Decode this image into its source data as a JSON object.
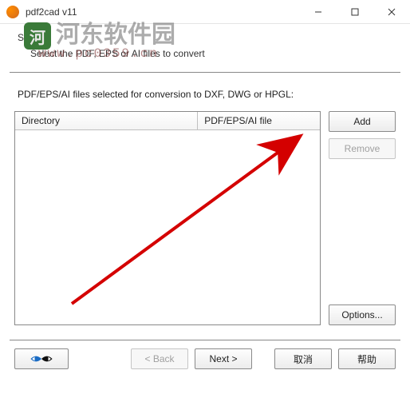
{
  "titlebar": {
    "title": "pdf2cad v11"
  },
  "step": {
    "title": "Step 1",
    "subtitle": "Select the PDF, EPS or AI files to convert"
  },
  "selection_label": "PDF/EPS/AI files selected for conversion to DXF, DWG or HPGL:",
  "table": {
    "col1": "Directory",
    "col2": "PDF/EPS/AI file"
  },
  "buttons": {
    "add": "Add",
    "remove": "Remove",
    "options": "Options...",
    "back": "< Back",
    "next": "Next >",
    "cancel": "取消",
    "help": "帮助"
  },
  "watermark": {
    "text": "河东软件园",
    "sub": "www.pc0359.cn"
  }
}
